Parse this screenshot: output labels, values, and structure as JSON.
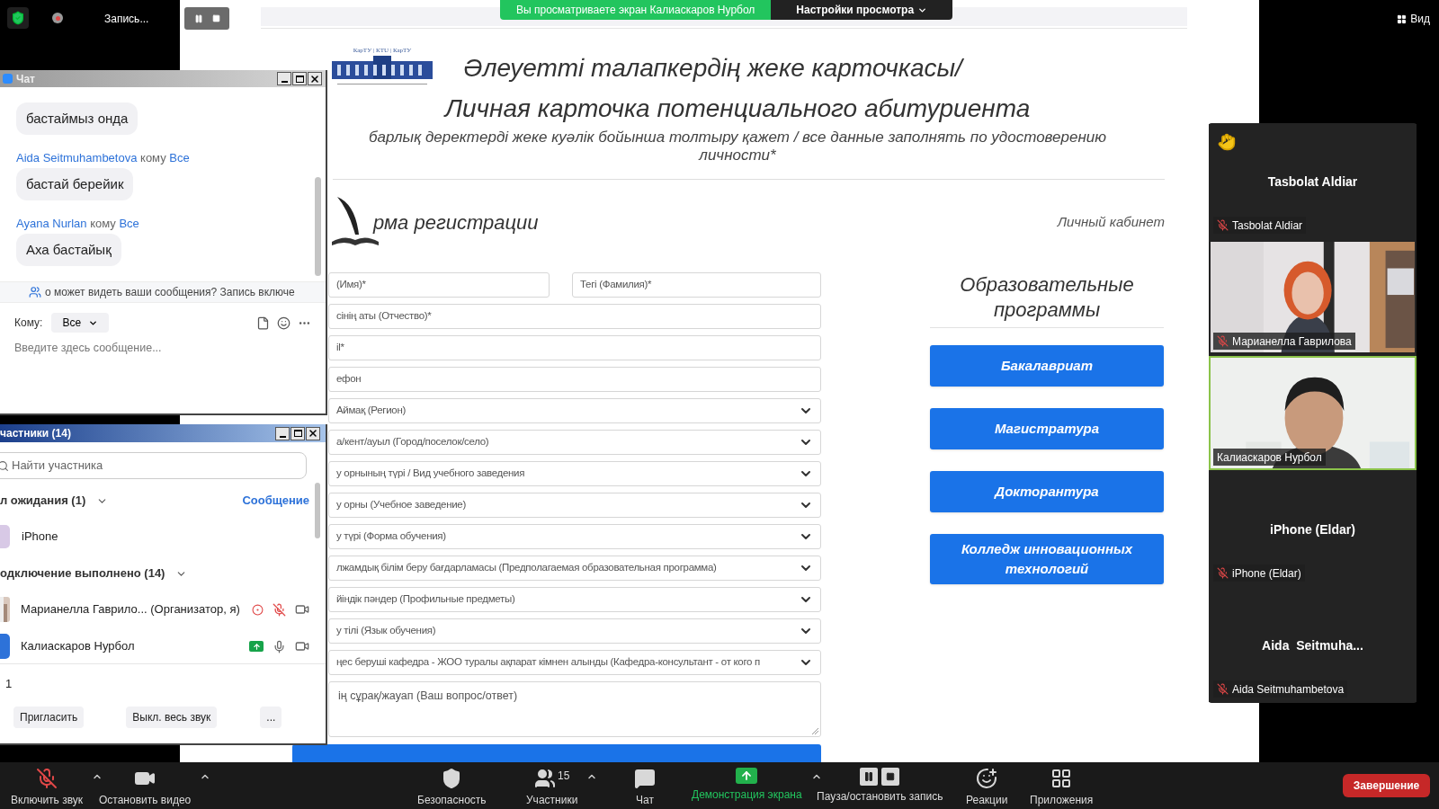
{
  "recording": {
    "label": "Запись..."
  },
  "share_banner": {
    "text": "Вы просматриваете экран Калиаскаров Нурбол",
    "settings": "Настройки просмотра"
  },
  "view_button": "Вид",
  "shared_page": {
    "logo_text": "КарТУ | КТU | КарТУ",
    "title_lines": [
      "Әлеуетті талапкердің жеке карточкасы/",
      "Личная карточка потенциального абитуриента"
    ],
    "subtitle": "барлық деректерді жеке куәлік бойынша толтыру қажет / все данные заполнять по удостоверению личности*",
    "form_title": "рма регистрации",
    "cabinet_link": "Личный кабинет",
    "name_fields": [
      {
        "text": "(Имя)*"
      },
      {
        "text": "Тегі (Фамилия)*"
      }
    ],
    "fields": [
      {
        "kind": "input",
        "text": "сінің аты (Отчество)*"
      },
      {
        "kind": "input",
        "text": "il*"
      },
      {
        "kind": "input",
        "text": "ефон"
      },
      {
        "kind": "select",
        "text": "Аймақ (Регион)"
      },
      {
        "kind": "select",
        "text": "а/кент/ауыл (Город/поселок/село)"
      },
      {
        "kind": "select",
        "text": "у орнының түрі / Вид учебного заведения"
      },
      {
        "kind": "select",
        "text": "у орны (Учебное заведение)"
      },
      {
        "kind": "select",
        "text": "у түрі (Форма обучения)"
      },
      {
        "kind": "select",
        "text": "лжамдық білім беру бағдарламасы (Предполагаемая образовательная программа)"
      },
      {
        "kind": "select",
        "text": "йіндік пәндер (Профильные предметы)"
      },
      {
        "kind": "select",
        "text": "у тілі (Язык обучения)"
      },
      {
        "kind": "select",
        "text": "ңес беруші кафедра - ЖОО туралы ақпарат кімнен алынды (Кафедра-консультант - от кого п"
      },
      {
        "kind": "textarea",
        "text": "ің сұрақ/жауап (Ваш вопрос/ответ)"
      }
    ],
    "programs": {
      "title": "Образовательные программы",
      "buttons": [
        "Бакалавриат",
        "Магистратура",
        "Докторантура",
        "Колледж инновационных технологий"
      ]
    }
  },
  "chat": {
    "title": "Чат",
    "messages": [
      {
        "text": "бастаймыз онда"
      },
      {
        "sender": "Aida Seitmuhambetova",
        "to_word": "кому",
        "recipient": "Все",
        "text": "бастай берейик"
      },
      {
        "sender": "Ayana Nurlan",
        "to_word": "кому",
        "recipient": "Все",
        "text": "Аха бастайық"
      }
    ],
    "notice": "о может видеть ваши сообщения? Запись включе",
    "to_label": "Кому:",
    "to_value": "Все",
    "input_placeholder": "Введите здесь сообщение..."
  },
  "participants": {
    "title": "частники (14)",
    "search_placeholder": "Найти участника",
    "waiting": {
      "title": "л ожидания (1)",
      "action": "Сообщение",
      "items": [
        {
          "name": "iPhone"
        }
      ]
    },
    "joined": {
      "title": "одключение выполнено (14)",
      "items": [
        {
          "name": "Марианелла Гаврило... (Организатор, я)",
          "recording": true,
          "sharing": false,
          "muted": true
        },
        {
          "name": "Калиаскаров Нурбол",
          "kind": "initial",
          "recording": false,
          "sharing": true,
          "muted": false
        }
      ]
    },
    "page": "1",
    "buttons": [
      "Пригласить",
      "Выкл. весь звук",
      "..."
    ]
  },
  "toolbar": {
    "items": [
      {
        "kind": "mic",
        "label": "Включить звук",
        "caret": true,
        "muted": true
      },
      {
        "kind": "video",
        "label": "Остановить видео",
        "caret": true
      },
      {
        "kind": "security",
        "label": "Безопасность",
        "caret": false
      },
      {
        "kind": "participants",
        "label": "Участники",
        "count": "15",
        "caret": true
      },
      {
        "kind": "chat",
        "label": "Чат",
        "caret": false
      },
      {
        "kind": "share",
        "label": "Демонстрация экрана",
        "caret": true
      },
      {
        "kind": "record",
        "label": "Пауза/остановить запись",
        "caret": false
      },
      {
        "kind": "reactions",
        "label": "Реакции",
        "caret": false
      },
      {
        "kind": "apps",
        "label": "Приложения",
        "caret": false
      }
    ],
    "end_button": "Завершение"
  },
  "video_tiles": [
    {
      "kind": "name",
      "title": "Tasbolat Aldiar",
      "label": "Tasbolat Aldiar",
      "muted": true,
      "hand_raised": true,
      "active_speaker": false
    },
    {
      "kind": "headset",
      "label": "Марианелла Гаврилова",
      "muted": true,
      "hand_raised": false,
      "active_speaker": false
    },
    {
      "kind": "closeup",
      "label": "Калиаскаров Нурбол",
      "muted": false,
      "hand_raised": false,
      "active_speaker": true
    },
    {
      "kind": "name",
      "title": "iPhone (Eldar)",
      "label": "iPhone (Eldar)",
      "muted": true,
      "hand_raised": false,
      "active_speaker": false
    },
    {
      "kind": "name",
      "title": "Aida  Seitmuha...",
      "label": "Aida Seitmuhambetova",
      "muted": true,
      "hand_raised": false,
      "active_speaker": false
    }
  ]
}
